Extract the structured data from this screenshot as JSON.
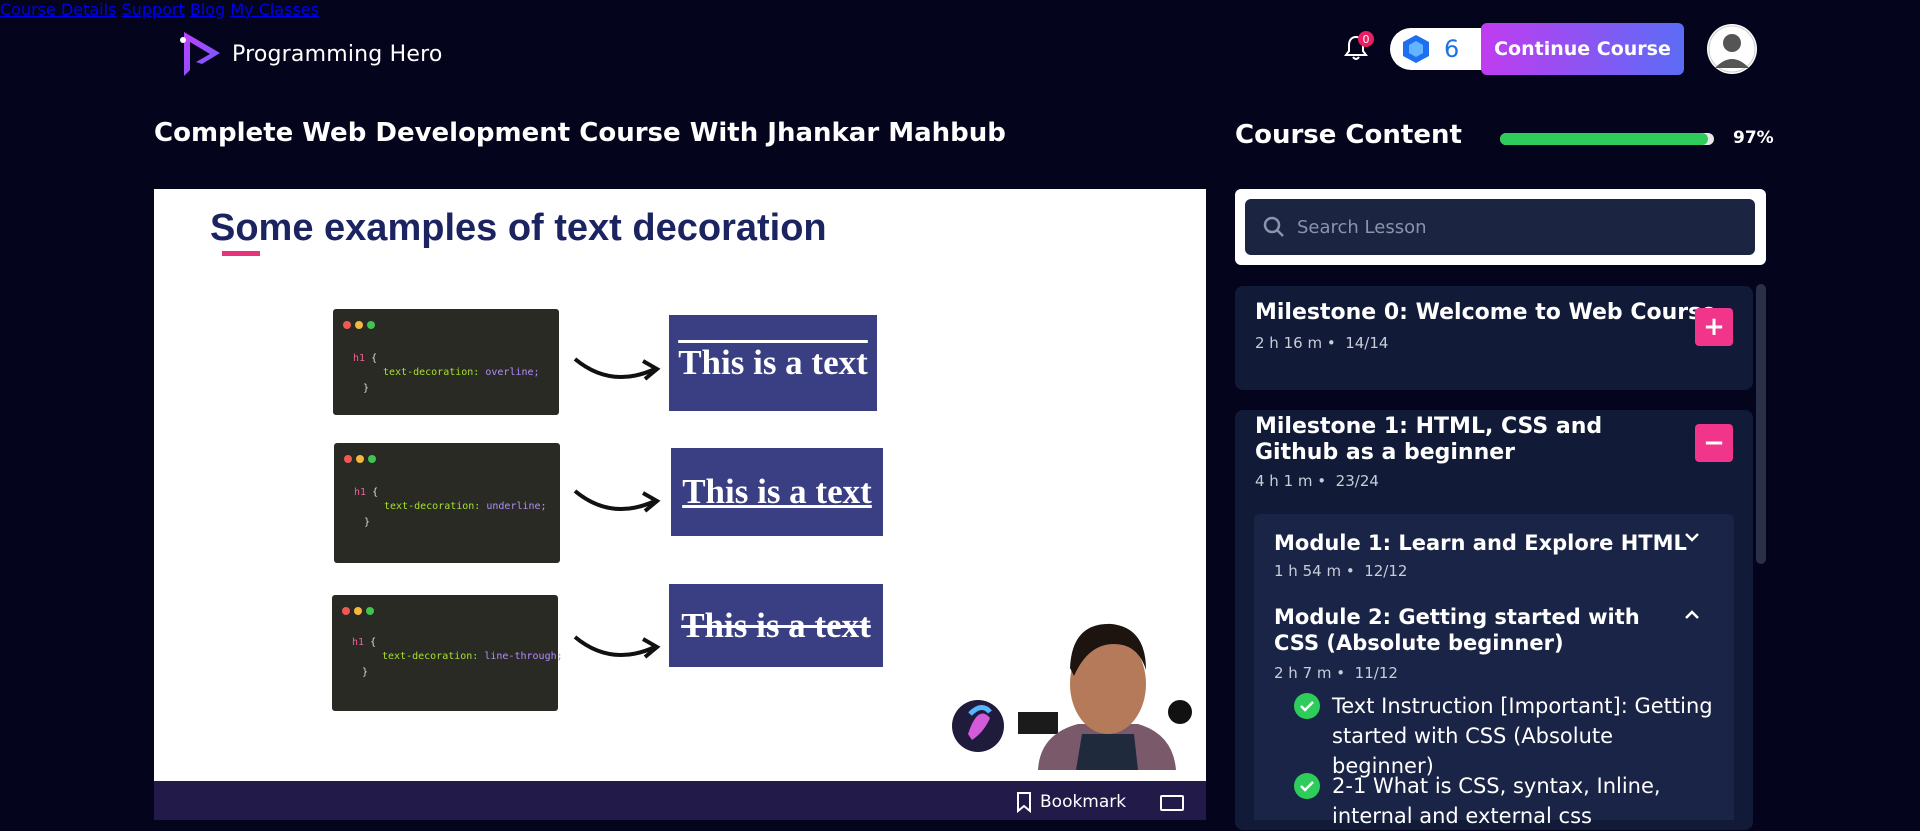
{
  "header": {
    "brand": "Programming Hero",
    "nav": [
      "Course Details",
      "Support",
      "Blog",
      "My Classes"
    ],
    "notification_count": "0",
    "gem_count": "6",
    "continue_label": "Continue Course"
  },
  "course": {
    "title": "Complete Web Development Course With Jhankar Mahbub"
  },
  "slide": {
    "title": "Some examples of text decoration",
    "examples": [
      {
        "selector": "h1",
        "property": "text-decoration:",
        "value": "overline;",
        "result": "This is a text"
      },
      {
        "selector": "h1",
        "property": "text-decoration:",
        "value": "underline;",
        "result": "This is a text"
      },
      {
        "selector": "h1",
        "property": "text-decoration:",
        "value": "line-through;",
        "result": "This is a text"
      }
    ]
  },
  "player": {
    "bookmark_label": "Bookmark"
  },
  "sidebar": {
    "title": "Course Content",
    "progress_percent": 97,
    "progress_label": "97%",
    "search_placeholder": "Search Lesson",
    "milestones": [
      {
        "title": "Milestone 0: Welcome to Web Course",
        "duration": "2 h 16 m",
        "count": "14/14",
        "button": "+"
      },
      {
        "title": "Milestone 1: HTML, CSS and Github as a beginner",
        "duration": "4 h 1 m",
        "count": "23/24",
        "button": "−"
      }
    ],
    "modules": [
      {
        "title": "Module 1: Learn and Explore HTML",
        "duration": "1 h 54 m",
        "count": "12/12"
      },
      {
        "title": "Module 2: Getting started with CSS (Absolute beginner)",
        "duration": "2 h 7 m",
        "count": "11/12"
      }
    ],
    "lessons": [
      "Text Instruction [Important]: Getting started with CSS (Absolute beginner)",
      "2-1 What is CSS, syntax, Inline, internal and external css"
    ]
  },
  "colors": {
    "background": "#04041c",
    "accent_pink": "#f0358a",
    "progress_green": "#2ecc5a",
    "panel": "#111a36"
  }
}
